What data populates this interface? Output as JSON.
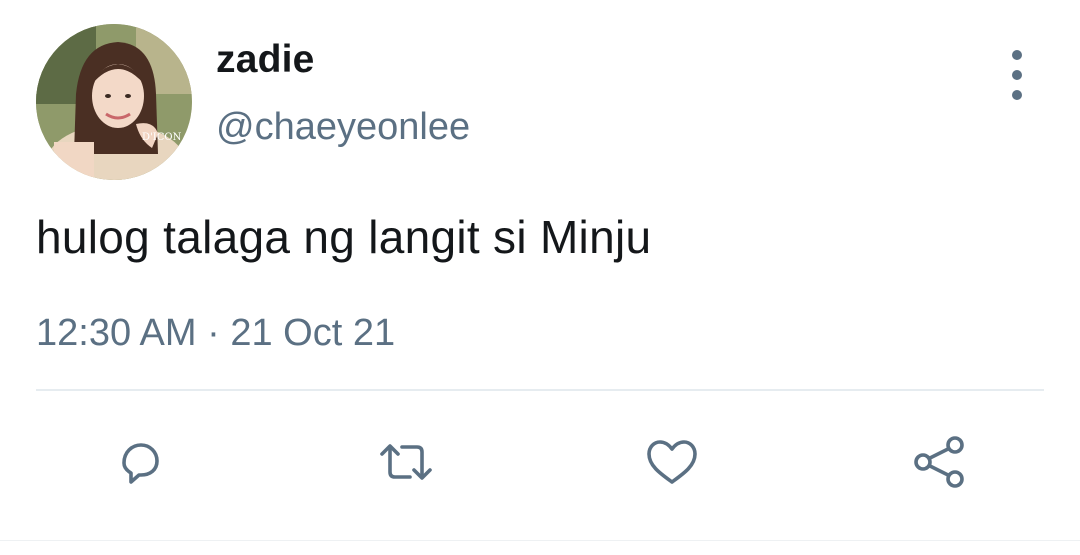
{
  "user": {
    "display_name": "zadie",
    "handle": "@chaeyeonlee",
    "avatar_watermark": "D'ICON"
  },
  "tweet": {
    "text": "hulog talaga ng langit si Minju",
    "timestamp": "12:30 AM · 21 Oct 21"
  },
  "actions": [
    {
      "name": "reply",
      "icon": "reply-icon"
    },
    {
      "name": "retweet",
      "icon": "retweet-icon"
    },
    {
      "name": "like",
      "icon": "heart-icon"
    },
    {
      "name": "share",
      "icon": "share-icon"
    }
  ],
  "colors": {
    "text": "#14171a",
    "secondary": "#5b7083",
    "divider": "#e6ecf0",
    "background": "#ffffff"
  }
}
